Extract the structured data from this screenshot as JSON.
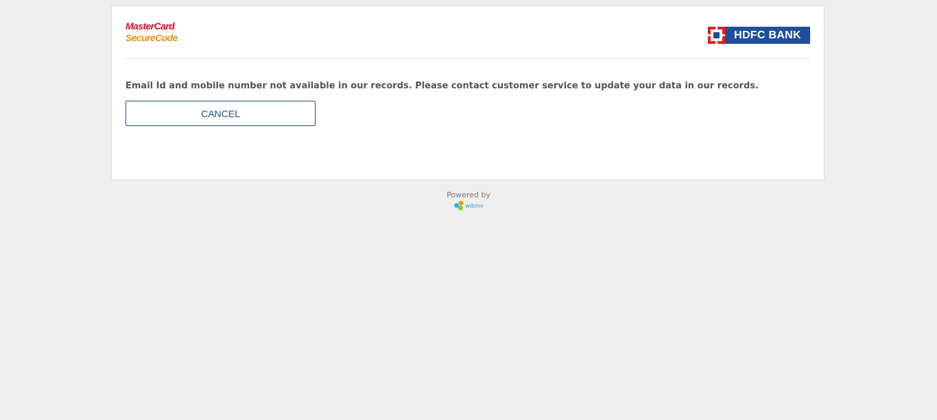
{
  "header": {
    "mastercard_logo": {
      "line1": "MasterCard",
      "line2": "SecureCode",
      "line1_color": "#c8102e",
      "line2_color": "#e39318"
    },
    "bank_logo": {
      "text": "HDFC BANK",
      "background_color": "#1f4e9c",
      "mark_color": "#e31e24"
    }
  },
  "main": {
    "message": "Email Id and mobile number not available in our records. Please contact customer service to update your data in our records.",
    "cancel_label": "CANCEL"
  },
  "footer": {
    "powered_by": "Powered by",
    "brand": "wibmo",
    "brand_colors": [
      "#f39c12",
      "#29b6e8",
      "#7ed321"
    ]
  }
}
